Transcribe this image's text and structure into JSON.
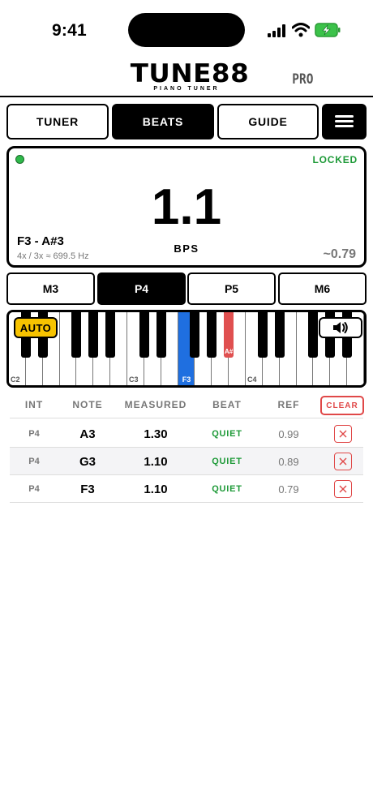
{
  "status_bar": {
    "time": "9:41"
  },
  "header": {
    "logo_title": "TUNE88",
    "logo_subtitle": "PIANO TUNER",
    "badge": "PRO"
  },
  "tabs": [
    {
      "label": "TUNER",
      "active": false
    },
    {
      "label": "BEATS",
      "active": true
    },
    {
      "label": "GUIDE",
      "active": false
    }
  ],
  "readout": {
    "status": "LOCKED",
    "value": "1.1",
    "unit": "BPS",
    "note_pair": "F3 - A#3",
    "ratio": "4x / 3x ≈ 699.5 Hz",
    "offset": "~0.79"
  },
  "intervals": [
    {
      "label": "M3",
      "active": false
    },
    {
      "label": "P4",
      "active": true
    },
    {
      "label": "P5",
      "active": false
    },
    {
      "label": "M6",
      "active": false
    }
  ],
  "keyboard": {
    "auto_label": "AUTO",
    "octave_labels": [
      "C2",
      "C3",
      "C4"
    ],
    "selected_white_label": "F3",
    "selected_black_label": "A#"
  },
  "table": {
    "headers": [
      "INT",
      "NOTE",
      "MEASURED",
      "BEAT",
      "REF"
    ],
    "clear_label": "CLEAR",
    "rows": [
      {
        "interval": "P4",
        "note": "A3",
        "measured": "1.30",
        "beat": "QUIET",
        "ref": "0.99"
      },
      {
        "interval": "P4",
        "note": "G3",
        "measured": "1.10",
        "beat": "QUIET",
        "ref": "0.89"
      },
      {
        "interval": "P4",
        "note": "F3",
        "measured": "1.10",
        "beat": "QUIET",
        "ref": "0.79"
      }
    ]
  },
  "colors": {
    "locked": "#1e9a38",
    "selected_white_key": "#1f6fe0",
    "selected_black_key": "#e05050",
    "auto_button": "#f7c300",
    "clear": "#e04848"
  },
  "icons": [
    "signal-icon",
    "wifi-icon",
    "battery-icon",
    "menu-icon",
    "speaker-icon",
    "close-icon"
  ]
}
